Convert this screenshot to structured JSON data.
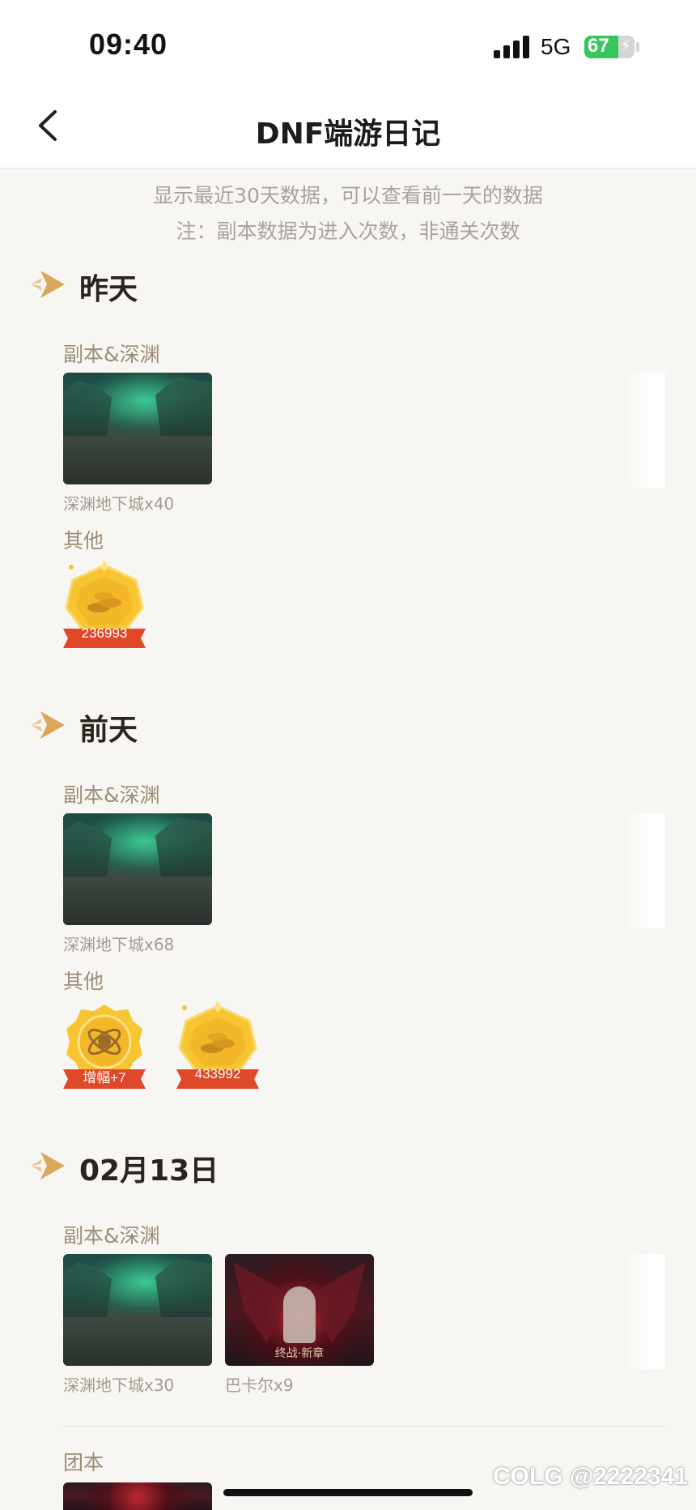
{
  "status_bar": {
    "time": "09:40",
    "network": "5G",
    "battery": "67",
    "battery_level": 0.67
  },
  "nav": {
    "title": "DNF端游日记",
    "back_icon": "chevron-left-icon"
  },
  "notice": {
    "line1": "显示最近30天数据，可以查看前一天的数据",
    "line2": "注：副本数据为进入次数，非通关次数"
  },
  "colors": {
    "accent_gold": "#d9a85b",
    "badge_gold": "#f6c531",
    "ribbon_red": "#e0482a",
    "title": "#2a241c",
    "sublabel": "#9c8d77",
    "caption": "#a49b8f"
  },
  "sections": [
    {
      "title": "昨天",
      "dungeon_label": "副本&深渊",
      "dungeons": [
        {
          "caption": "深渊地下城x40",
          "image": "abyss-dungeon"
        }
      ],
      "other_label": "其他",
      "others": [
        {
          "value": "236993",
          "icon": "gold-coins-icon"
        }
      ]
    },
    {
      "title": "前天",
      "dungeon_label": "副本&深渊",
      "dungeons": [
        {
          "caption": "深渊地下城x68",
          "image": "abyss-dungeon"
        }
      ],
      "other_label": "其他",
      "others": [
        {
          "value": "增幅+7",
          "icon": "amplify-icon"
        },
        {
          "value": "433992",
          "icon": "gold-coins-icon"
        }
      ]
    },
    {
      "title": "02月13日",
      "dungeon_label": "副本&深渊",
      "dungeons": [
        {
          "caption": "深渊地下城x30",
          "image": "abyss-dungeon"
        },
        {
          "caption": "巴卡尔x9",
          "image": "bakal-raid",
          "image_text": "终战·新章"
        }
      ],
      "raid_label": "团本"
    }
  ],
  "watermark": "COLG @2222341"
}
